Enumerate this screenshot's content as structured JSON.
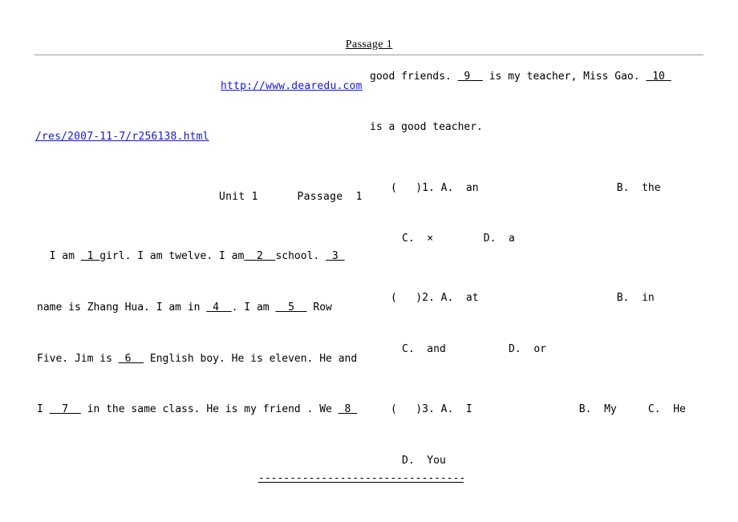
{
  "header": {
    "title": "Passage  1"
  },
  "links": {
    "site_url": "http://www.dearedu.com",
    "resource_path": "/res/2007-11-7/r256138.html"
  },
  "worksheet": {
    "unit_heading": "Unit 1      Passage  1"
  },
  "passage": {
    "line1": {
      "seg1": "  I am ",
      "blank1": " 1 ",
      "seg2": "girl. I am twelve. I am",
      "blank2": "  2  ",
      "seg3": "school. ",
      "blank3": " 3 "
    },
    "line2": {
      "seg1": "name is Zhang Hua. I am in ",
      "blank4": " 4  ",
      "seg2": ". I am ",
      "blank5": "  5  ",
      "seg3": " Row"
    },
    "line3": {
      "seg1": "Five. Jim is ",
      "blank6": " 6  ",
      "seg2": " English boy. He is eleven. He and"
    },
    "line4": {
      "seg1": "I ",
      "blank7": "  7  ",
      "seg2": " in the same class. He is my friend . We ",
      "blank8": " 8 "
    },
    "line5": {
      "seg1": "good friends. ",
      "blank9": " 9  ",
      "seg2": " is my teacher, Miss Gao. ",
      "blank10": " 10 "
    },
    "line6": {
      "seg1": "is a good teacher."
    }
  },
  "questions": [
    {
      "marker": "(   )1.",
      "number": "1",
      "row_a": "(   )1. A.  an                      B.  the",
      "row_b": "C.  ×        D.  a",
      "options": [
        {
          "letter": "A.",
          "text": "an"
        },
        {
          "letter": "B.",
          "text": "the"
        },
        {
          "letter": "C.",
          "text": "×"
        },
        {
          "letter": "D.",
          "text": "a"
        }
      ]
    },
    {
      "marker": "(   )2.",
      "number": "2",
      "row_a": "(   )2. A.  at                      B.  in",
      "row_b": "C.  and          D.  or",
      "options": [
        {
          "letter": "A.",
          "text": "at"
        },
        {
          "letter": "B.",
          "text": "in"
        },
        {
          "letter": "C.",
          "text": "and"
        },
        {
          "letter": "D.",
          "text": "or"
        }
      ]
    },
    {
      "marker": "(   )3.",
      "number": "3",
      "row_a": "(   )3. A.  I                 B.  My     C.  He",
      "row_b": "D.  You",
      "options": [
        {
          "letter": "A.",
          "text": "I"
        },
        {
          "letter": "B.",
          "text": "My"
        },
        {
          "letter": "C.",
          "text": "He"
        },
        {
          "letter": "D.",
          "text": "You"
        }
      ]
    }
  ],
  "footer": {
    "divider": "------------------------------------------------------"
  }
}
